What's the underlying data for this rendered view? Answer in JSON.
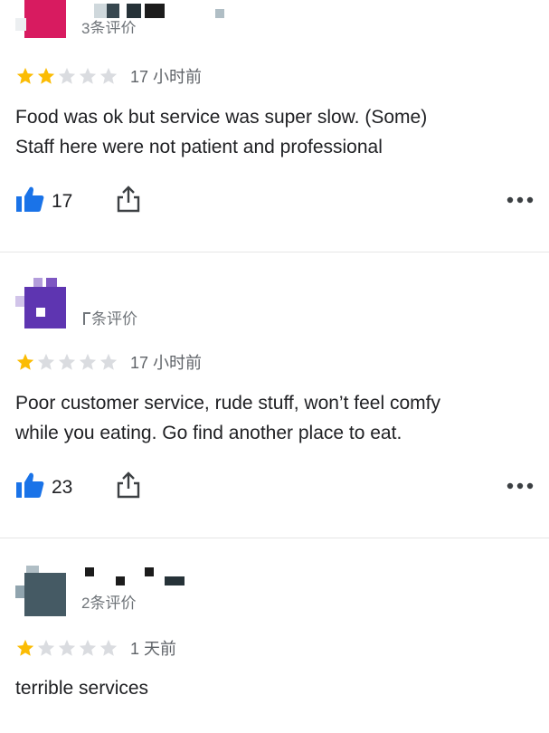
{
  "colors": {
    "star_filled": "#fbbc04",
    "star_empty": "#dadce0",
    "like_blue": "#1a73e8",
    "divider": "#e6e6e6"
  },
  "reviews": [
    {
      "review_count_label": "3条评价",
      "rating": 2,
      "max_rating": 5,
      "time": "17 小时前",
      "text_line1": "Food was ok but service was super slow. (Some)",
      "text_line2": "Staff here were not  patient and professional",
      "likes": "17",
      "avatar_color": "#d81b60",
      "avatar_icon": "pixelated-avatar-icon"
    },
    {
      "review_count_label": "条评价",
      "rating": 1,
      "max_rating": 5,
      "time": "17 小时前",
      "text_line1": "Poor customer service, rude stuff, won’t feel comfy",
      "text_line2": "while you eating. Go find another place to eat.",
      "likes": "23",
      "avatar_color": "#5e35b1",
      "avatar_icon": "pixelated-avatar-icon"
    },
    {
      "review_count_label": "2条评价",
      "rating": 1,
      "max_rating": 5,
      "time": "1 天前",
      "text_line1": "terrible services",
      "avatar_color": "#455a64",
      "avatar_icon": "pixelated-avatar-icon"
    }
  ]
}
